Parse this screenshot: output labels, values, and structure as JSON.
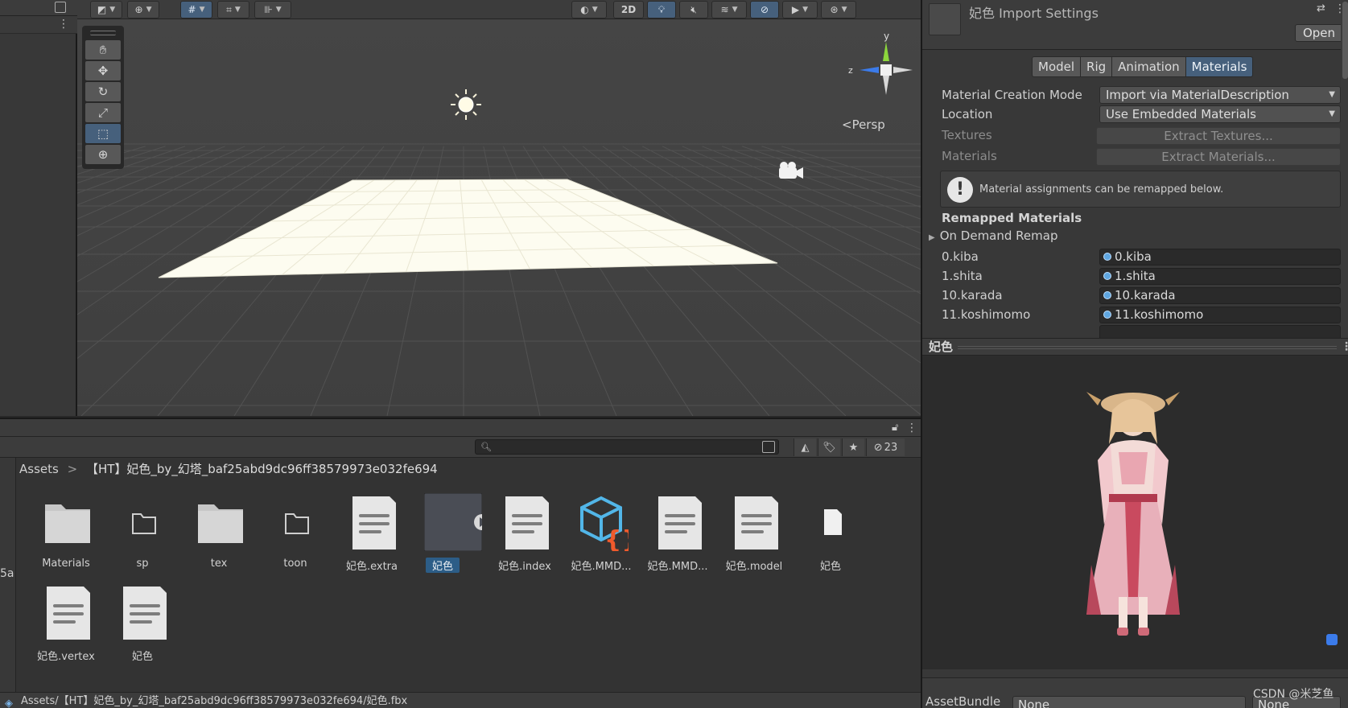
{
  "colors": {
    "scene_bg": "#454545",
    "panel_bg": "#383838",
    "accent_blue": "#46607c",
    "selection": "#2c5d87",
    "plane": "#fdfcf0"
  },
  "scene": {
    "toolbar": {
      "mode_2d": "2D",
      "hidden_count_icon": "eye-hidden-icon"
    },
    "persp_label": "<Persp",
    "gizmo": {
      "y_label": "y",
      "z_label": "z"
    }
  },
  "project": {
    "hidden_count": "23",
    "search_placeholder": "",
    "left_edge_label": "5a",
    "breadcrumb": {
      "root": "Assets",
      "separator": ">",
      "current": "【HT】妃色_by_幻塔_baf25abd9dc96ff38579973e032fe694"
    },
    "assets": [
      {
        "label": "Materials",
        "kind": "folder-filled"
      },
      {
        "label": "sp",
        "kind": "folder-empty"
      },
      {
        "label": "tex",
        "kind": "folder-filled"
      },
      {
        "label": "toon",
        "kind": "folder-empty"
      },
      {
        "label": "妃色.extra",
        "kind": "text-file"
      },
      {
        "label": "妃色",
        "kind": "model-selected"
      },
      {
        "label": "妃色.index",
        "kind": "text-file"
      },
      {
        "label": "妃色.MMD...",
        "kind": "json-cube"
      },
      {
        "label": "妃色.MMD...",
        "kind": "text-file"
      },
      {
        "label": "妃色.model",
        "kind": "text-file"
      },
      {
        "label": "妃色",
        "kind": "blank-file"
      },
      {
        "label": "妃色.vertex",
        "kind": "text-file"
      },
      {
        "label": "妃色",
        "kind": "text-file"
      }
    ],
    "status_path": "Assets/【HT】妃色_by_幻塔_baf25abd9dc96ff38579973e032fe694/妃色.fbx"
  },
  "inspector": {
    "title": "妃色 Import Settings",
    "open_label": "Open",
    "tabs": [
      "Model",
      "Rig",
      "Animation",
      "Materials"
    ],
    "active_tab": "Materials",
    "fields": {
      "creation_mode_label": "Material Creation Mode",
      "creation_mode_value": "Import via MaterialDescription",
      "location_label": "Location",
      "location_value": "Use Embedded Materials",
      "textures_label": "Textures",
      "extract_textures": "Extract Textures...",
      "materials_label": "Materials",
      "extract_materials": "Extract Materials..."
    },
    "help_text": "Material assignments can be remapped below.",
    "remapped_header": "Remapped Materials",
    "on_demand_remap": "On Demand Remap",
    "remaps": [
      {
        "name": "0.kiba",
        "value": "0.kiba"
      },
      {
        "name": "1.shita",
        "value": "1.shita"
      },
      {
        "name": "10.karada",
        "value": "10.karada"
      },
      {
        "name": "11.koshimomo",
        "value": "11.koshimomo"
      }
    ],
    "preview_title": "妃色",
    "assetbundle_label": "AssetBundle",
    "assetbundle_value": "None",
    "assetbundle_variant": "None"
  },
  "watermark": "CSDN @米芝鱼"
}
